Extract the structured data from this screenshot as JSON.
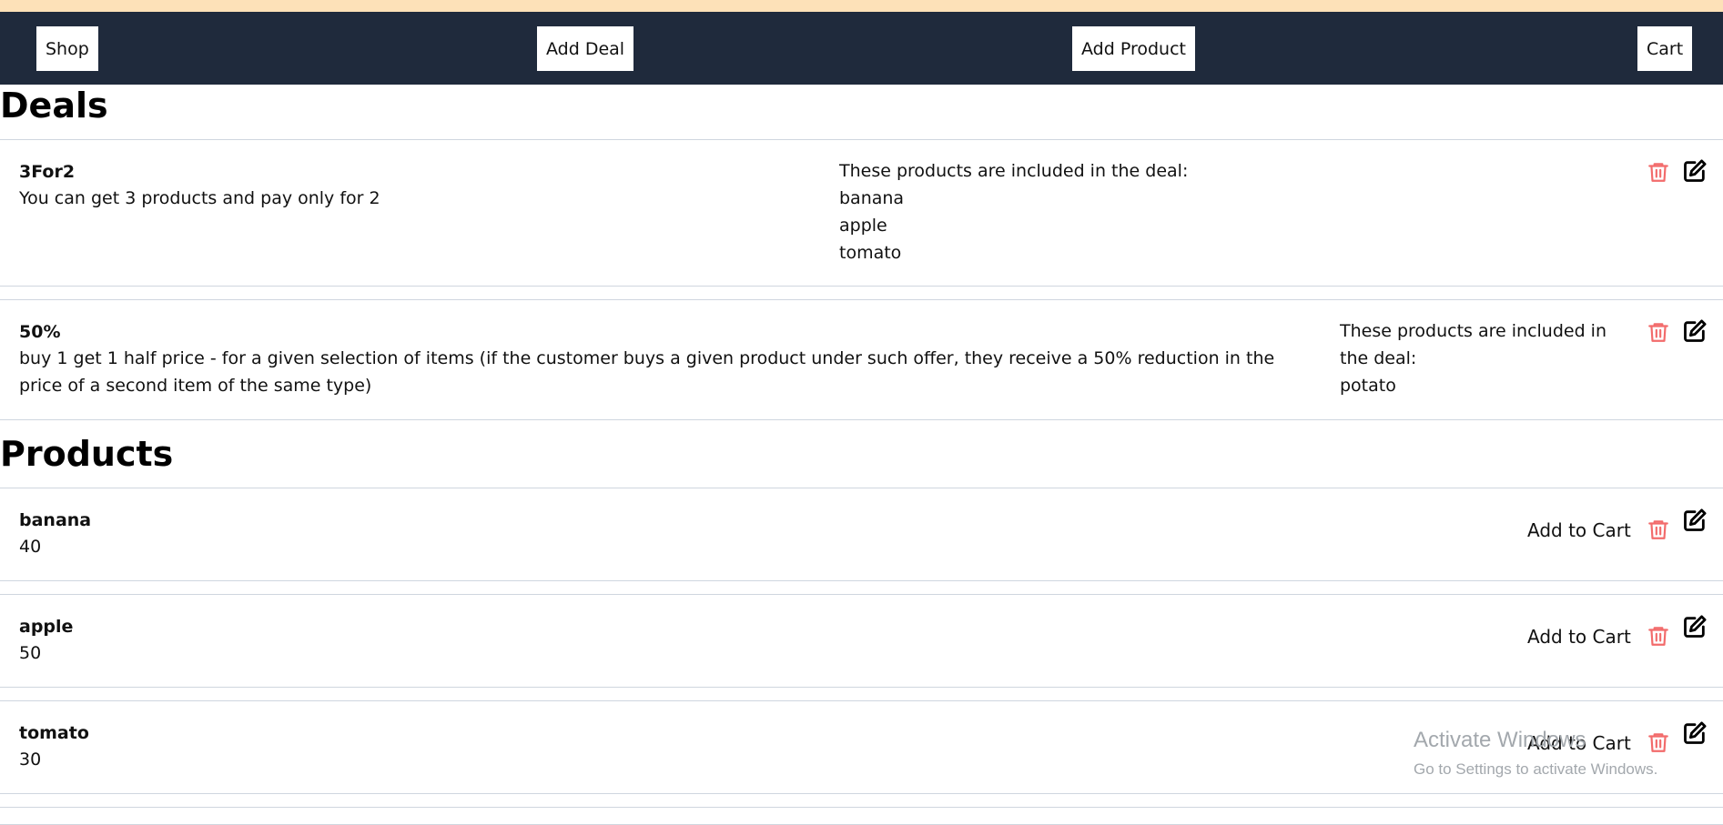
{
  "nav": {
    "shop": "Shop",
    "add_deal": "Add Deal",
    "add_product": "Add Product",
    "cart": "Cart"
  },
  "deals_title": "Deals",
  "deals": [
    {
      "name": "3For2",
      "description": "You can get 3 products and pay only for 2",
      "products_heading": "These products are included in the deal:",
      "products": [
        "banana",
        "apple",
        "tomato"
      ]
    },
    {
      "name": "50%",
      "description": "buy 1 get 1 half price - for a given selection of items (if the customer buys a given product under such offer, they receive a 50% reduction in the price of a second item of the same type)",
      "products_heading": "These products are included in the deal:",
      "products": [
        "potato"
      ]
    }
  ],
  "products_title": "Products",
  "products": [
    {
      "name": "banana",
      "price": "40",
      "add_to_cart": "Add to Cart"
    },
    {
      "name": "apple",
      "price": "50",
      "add_to_cart": "Add to Cart"
    },
    {
      "name": "tomato",
      "price": "30",
      "add_to_cart": "Add to Cart"
    }
  ],
  "icons": {
    "delete": "trash-icon",
    "edit": "edit-icon"
  },
  "colors": {
    "navbar": "#1f2a3c",
    "top_strip": "#fde1b8",
    "delete_icon": "#f26b6b"
  },
  "watermark": {
    "line1": "Activate Windows",
    "line2": "Go to Settings to activate Windows."
  }
}
